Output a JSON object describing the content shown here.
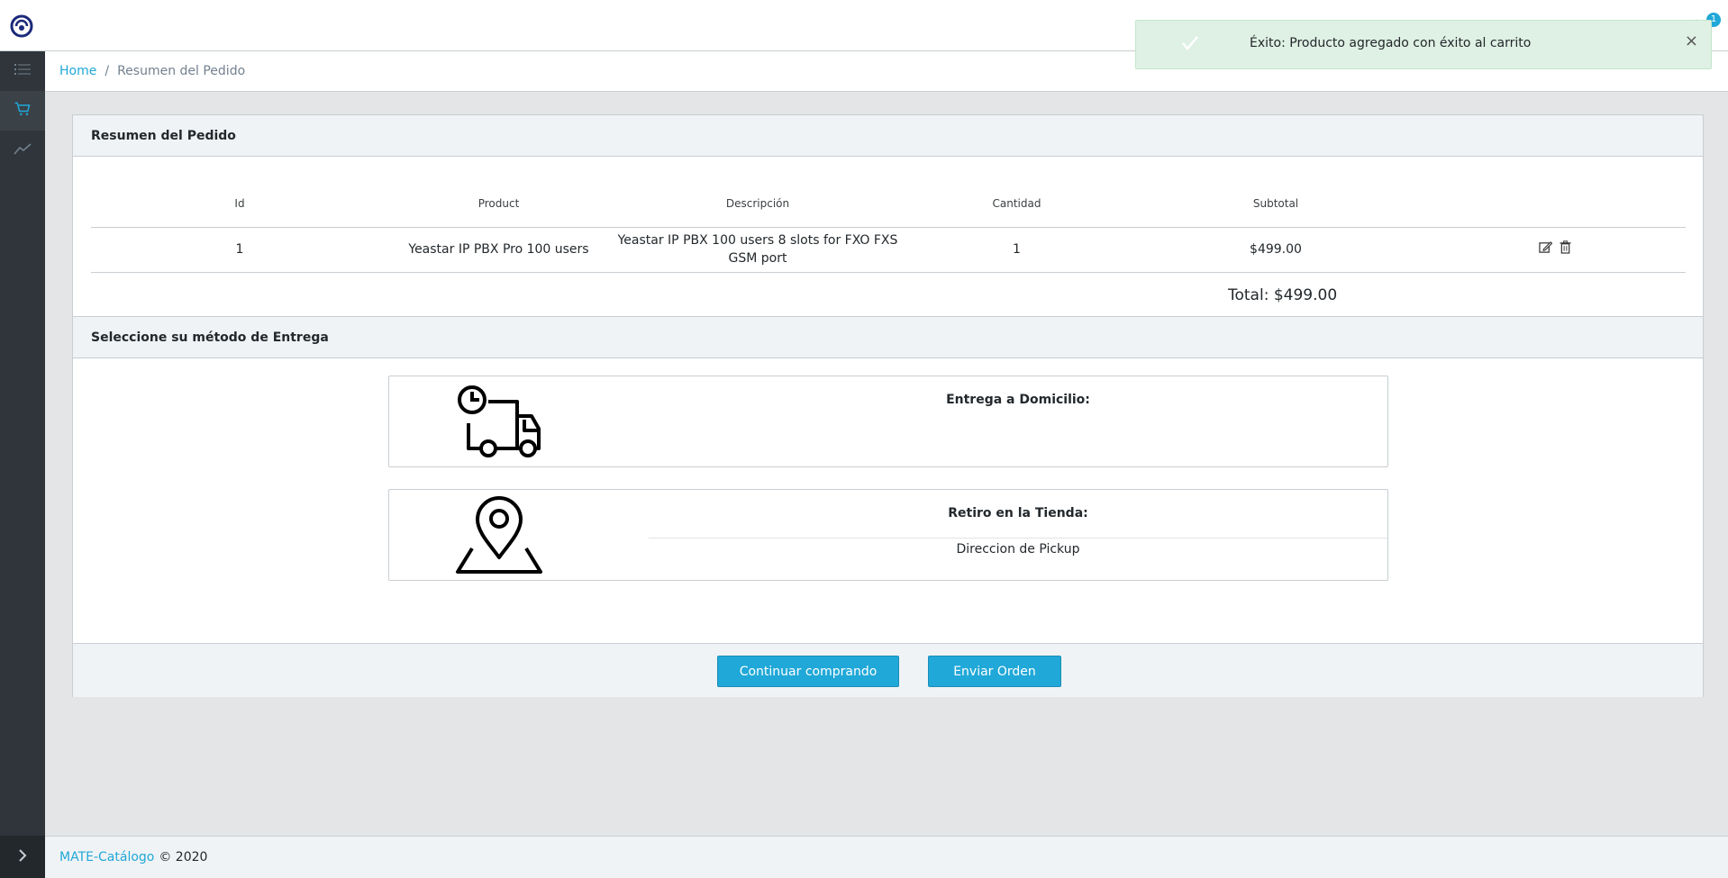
{
  "header": {
    "cart_badge": "1"
  },
  "breadcrumb": {
    "home": "Home",
    "separator": "/",
    "current": "Resumen del Pedido"
  },
  "order": {
    "title": "Resumen del Pedido",
    "columns": [
      "Id",
      "Product",
      "Descripción",
      "Cantidad",
      "Subtotal",
      ""
    ],
    "rows": [
      {
        "id": "1",
        "product": "Yeastar IP PBX Pro 100 users",
        "description": "Yeastar IP PBX 100 users 8 slots for FXO FXS GSM port",
        "quantity": "1",
        "subtotal": "$499.00"
      }
    ],
    "total": "Total: $499.00"
  },
  "delivery": {
    "title": "Seleccione su método de Entrega",
    "options": [
      {
        "title": "Entrega a Domicilio:",
        "subtitle": ""
      },
      {
        "title": "Retiro en la Tienda:",
        "subtitle": "Direccion de Pickup"
      }
    ]
  },
  "actions": {
    "continue": "Continuar comprando",
    "send": "Enviar Orden"
  },
  "toast": {
    "message": "Éxito: Producto agregado con éxito al carrito",
    "close": "×"
  },
  "footer": {
    "brand": "MATE-Catálogo",
    "copyright": "© 2020"
  },
  "colors": {
    "accent": "#20a8d8",
    "sidebar": "#2f353a",
    "toast_bg": "#dff0e4"
  }
}
